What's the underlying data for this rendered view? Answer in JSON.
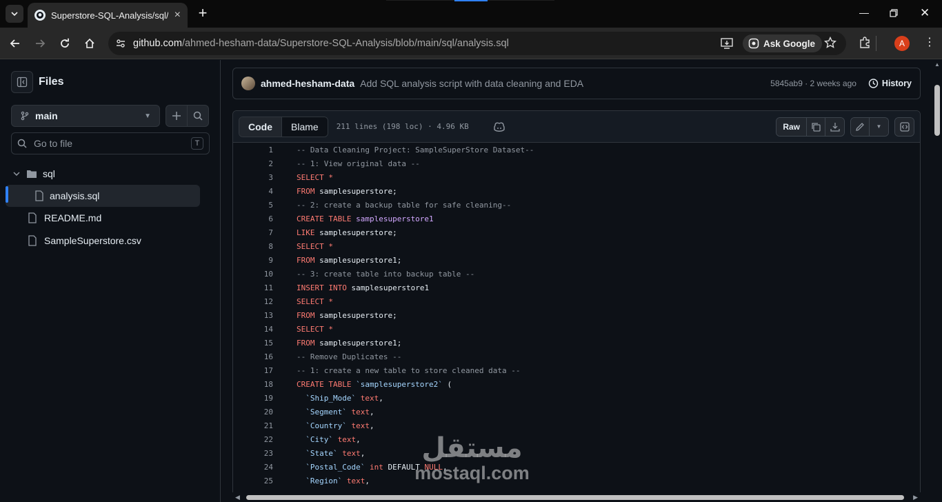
{
  "browser": {
    "tab_title": "Superstore-SQL-Analysis/sql/an",
    "url_host": "github.com",
    "url_path": "/ahmed-hesham-data/Superstore-SQL-Analysis/blob/main/sql/analysis.sql",
    "ask_google": "Ask Google",
    "profile_initial": "A"
  },
  "sidebar": {
    "title": "Files",
    "branch": "main",
    "goto_placeholder": "Go to file",
    "goto_shortcut": "T",
    "tree": [
      {
        "label": "sql",
        "type": "folder"
      },
      {
        "label": "analysis.sql",
        "type": "file"
      },
      {
        "label": "README.md",
        "type": "file"
      },
      {
        "label": "SampleSuperstore.csv",
        "type": "file"
      }
    ]
  },
  "commit": {
    "author": "ahmed-hesham-data",
    "message": "Add SQL analysis script with data cleaning and EDA",
    "meta": "5845ab9 · 2 weeks ago",
    "history_label": "History"
  },
  "file_header": {
    "tab_code": "Code",
    "tab_blame": "Blame",
    "info": "211 lines (198 loc) · 4.96 KB",
    "raw_label": "Raw"
  },
  "code": [
    {
      "n": "1",
      "t": [
        [
          "c",
          "-- Data Cleaning Project: SampleSuperStore Dataset--"
        ]
      ]
    },
    {
      "n": "2",
      "t": [
        [
          "c",
          "-- 1: View original data --"
        ]
      ]
    },
    {
      "n": "3",
      "t": [
        [
          "k",
          "SELECT *"
        ]
      ]
    },
    {
      "n": "4",
      "t": [
        [
          "k",
          "FROM "
        ],
        [
          "p",
          "samplesuperstore;"
        ]
      ]
    },
    {
      "n": "5",
      "t": [
        [
          "c",
          "-- 2: create a backup table for safe cleaning--"
        ]
      ]
    },
    {
      "n": "6",
      "t": [
        [
          "k",
          "CREATE TABLE "
        ],
        [
          "e",
          "samplesuperstore1"
        ]
      ]
    },
    {
      "n": "7",
      "t": [
        [
          "k",
          "LIKE "
        ],
        [
          "p",
          "samplesuperstore;"
        ]
      ]
    },
    {
      "n": "8",
      "t": [
        [
          "k",
          "SELECT *"
        ]
      ]
    },
    {
      "n": "9",
      "t": [
        [
          "k",
          "FROM "
        ],
        [
          "p",
          "samplesuperstore1;"
        ]
      ]
    },
    {
      "n": "10",
      "t": [
        [
          "c",
          "-- 3: create table into backup table --"
        ]
      ]
    },
    {
      "n": "11",
      "t": [
        [
          "k",
          "INSERT INTO "
        ],
        [
          "p",
          "samplesuperstore1"
        ]
      ]
    },
    {
      "n": "12",
      "t": [
        [
          "k",
          "SELECT *"
        ]
      ]
    },
    {
      "n": "13",
      "t": [
        [
          "k",
          "FROM "
        ],
        [
          "p",
          "samplesuperstore;"
        ]
      ]
    },
    {
      "n": "14",
      "t": [
        [
          "k",
          "SELECT *"
        ]
      ]
    },
    {
      "n": "15",
      "t": [
        [
          "k",
          "FROM "
        ],
        [
          "p",
          "samplesuperstore1;"
        ]
      ]
    },
    {
      "n": "16",
      "t": [
        [
          "c",
          "-- Remove Duplicates --"
        ]
      ]
    },
    {
      "n": "17",
      "t": [
        [
          "c",
          "-- 1: create a new table to store cleaned data --"
        ]
      ]
    },
    {
      "n": "18",
      "t": [
        [
          "k",
          "CREATE TABLE "
        ],
        [
          "s",
          "`samplesuperstore2`"
        ],
        [
          "p",
          " ("
        ]
      ]
    },
    {
      "n": "19",
      "t": [
        [
          "p",
          "  "
        ],
        [
          "s",
          "`Ship_Mode`"
        ],
        [
          "k",
          " text"
        ],
        [
          "p",
          ","
        ]
      ]
    },
    {
      "n": "20",
      "t": [
        [
          "p",
          "  "
        ],
        [
          "s",
          "`Segment`"
        ],
        [
          "k",
          " text"
        ],
        [
          "p",
          ","
        ]
      ]
    },
    {
      "n": "21",
      "t": [
        [
          "p",
          "  "
        ],
        [
          "s",
          "`Country`"
        ],
        [
          "k",
          " text"
        ],
        [
          "p",
          ","
        ]
      ]
    },
    {
      "n": "22",
      "t": [
        [
          "p",
          "  "
        ],
        [
          "s",
          "`City`"
        ],
        [
          "k",
          " text"
        ],
        [
          "p",
          ","
        ]
      ]
    },
    {
      "n": "23",
      "t": [
        [
          "p",
          "  "
        ],
        [
          "s",
          "`State`"
        ],
        [
          "k",
          " text"
        ],
        [
          "p",
          ","
        ]
      ]
    },
    {
      "n": "24",
      "t": [
        [
          "p",
          "  "
        ],
        [
          "s",
          "`Postal_Code`"
        ],
        [
          "k",
          " int "
        ],
        [
          "p",
          "DEFAULT "
        ],
        [
          "k",
          "NULL"
        ],
        [
          "p",
          ","
        ]
      ]
    },
    {
      "n": "25",
      "t": [
        [
          "p",
          "  "
        ],
        [
          "s",
          "`Region`"
        ],
        [
          "k",
          " text"
        ],
        [
          "p",
          ","
        ]
      ]
    }
  ],
  "watermark": {
    "arabic": "مستقل",
    "latin": "mostaql.com"
  }
}
